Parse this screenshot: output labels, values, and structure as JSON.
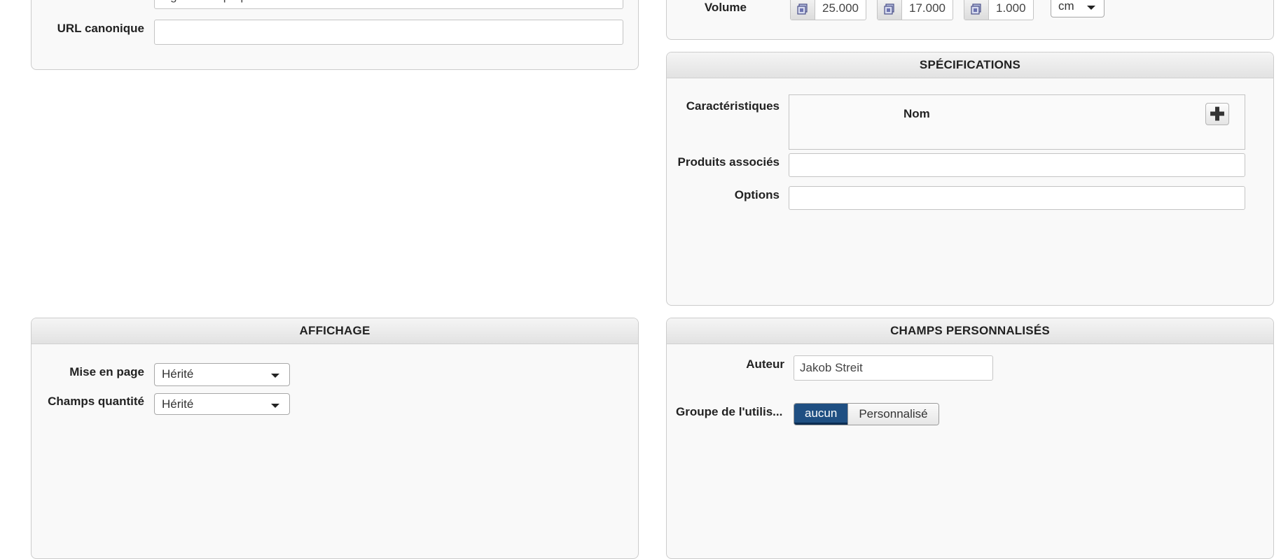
{
  "left_top": {
    "partial_value": "tagneau de paque",
    "canonical_label": "URL canonique",
    "canonical_value": ""
  },
  "dimensions": {
    "label": "Volume",
    "length": "25.000",
    "width": "17.000",
    "height": "1.000",
    "unit": "cm"
  },
  "specs": {
    "title": "SPÉCIFICATIONS",
    "characteristics_label": "Caractéristiques",
    "name_column": "Nom",
    "related_label": "Produits associés",
    "related_value": "",
    "options_label": "Options",
    "options_value": ""
  },
  "display": {
    "title": "AFFICHAGE",
    "layout_label": "Mise en page",
    "layout_value": "Hérité",
    "qty_label": "Champs quantité",
    "qty_value": "Hérité"
  },
  "custom": {
    "title": "CHAMPS PERSONNALISÉS",
    "author_label": "Auteur",
    "author_value": "Jakob Streit",
    "group_label": "Groupe de l'utilis...",
    "group_options": [
      "aucun",
      "Personnalisé"
    ],
    "group_selected": "aucun"
  },
  "colors": {
    "active_toggle": "#1f4f82",
    "panel_bg": "#f9f9f9",
    "panel_border": "#cccccc"
  }
}
